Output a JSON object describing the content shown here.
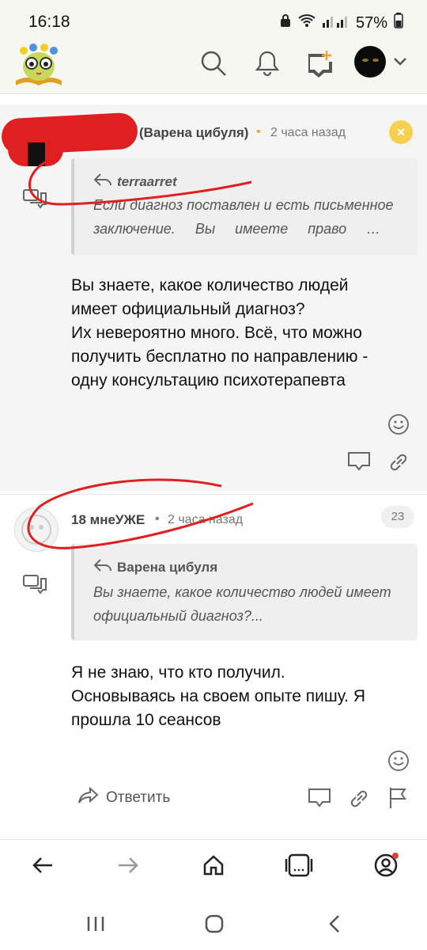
{
  "status_bar": {
    "time": "16:18",
    "battery": "57%"
  },
  "header": {
    "logo_icon": "book-owl-logo-icon",
    "search_icon": "search-icon",
    "notifications_icon": "bell-icon",
    "new_post_icon": "add-comment-icon",
    "avatar_icon": "avatar",
    "menu_chevron": "chevron-down-icon"
  },
  "comments": [
    {
      "author": "(Варена цибуля)",
      "time": "2 часа назад",
      "quote_author": "terraarret",
      "quote_line1": "Если диагноз поставлен и есть письменное",
      "quote_line2": "заключение.     Вы     имеете     право     …",
      "body_lines": [
        "Вы знаете, какое количество людей",
        "имеет официальный диагноз?",
        "Их невероятно много. Всё, что можно",
        "получить бесплатно по направлению -",
        "одну консультацию психотерапевта"
      ],
      "close_label": "×"
    },
    {
      "author": "18 мнеУЖЕ",
      "time": "2 часа назад",
      "count": "23",
      "quote_author": "Варена цибуля",
      "quote_line1": "Вы знаете, какое количество людей имеет",
      "quote_line2": "официальный диагноз?...",
      "body_lines": [
        "Я не знаю, что кто получил.",
        "Основываясь на своем опыте пишу. Я",
        "прошла 10 сеансов"
      ],
      "reply_label": "Ответить"
    }
  ],
  "accent_color": "#f0a030",
  "annotation_color": "#e02020"
}
